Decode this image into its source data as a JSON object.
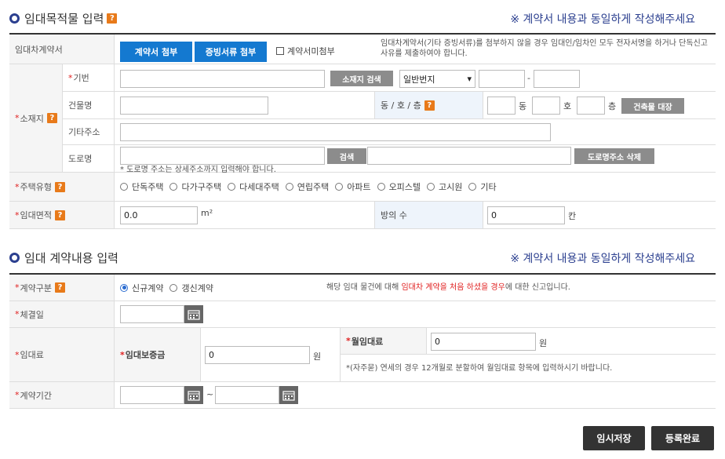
{
  "section1": {
    "title": "임대목적물 입력",
    "notice": "※ 계약서 내용과 동일하게 작성해주세요",
    "contract_row": {
      "label": "임대차계약서",
      "attach_contract": "계약서 첨부",
      "attach_proof": "증빙서류 첨부",
      "no_contract_label": "계약서미첨부",
      "note": "임대차계약서(기타 증빙서류)를 첨부하지 않을 경우 임대인/임차인 모두 전자서명을 하거나 단독신고 사유를 제출하여야 합니다."
    },
    "location": {
      "label": "소재지",
      "jibun_label": "기번",
      "search_location": "소재지 검색",
      "lot_type": "일반번지",
      "building_label": "건물명",
      "dong_ho_label": "동 / 호 / 층",
      "dong_unit": "동",
      "ho_unit": "호",
      "floor_unit": "층",
      "register_button": "건축물 대장",
      "other_addr_label": "기타주소",
      "road_label": "도로명",
      "search": "검색",
      "delete_road": "도로명주소 삭제",
      "road_note": "* 도로명 주소는 상세주소까지 입력해야 합니다."
    },
    "housing": {
      "label": "주택유형",
      "options": [
        "단독주택",
        "다가구주택",
        "다세대주택",
        "연립주택",
        "아파트",
        "오피스텔",
        "고시원",
        "기타"
      ]
    },
    "area": {
      "label": "임대면적",
      "value": "0.0",
      "unit": "m²",
      "rooms_label": "방의 수",
      "rooms_value": "0",
      "rooms_unit": "칸"
    }
  },
  "section2": {
    "title": "임대 계약내용 입력",
    "notice": "※ 계약서 내용과 동일하게 작성해주세요",
    "contract_type": {
      "label": "계약구분",
      "options": [
        "신규계약",
        "갱신계약"
      ],
      "note_pre": "해당 임대 물건에 대해 ",
      "note_red": "임대차 계약을 처음 하셨을 경우",
      "note_post": "에 대한 신고입니다."
    },
    "sign_date_label": "체결일",
    "rent": {
      "label": "임대료",
      "deposit_label": "임대보증금",
      "deposit_value": "0",
      "deposit_unit": "원",
      "monthly_label": "월임대료",
      "monthly_value": "0",
      "monthly_unit": "원",
      "monthly_note": "*(자주묻) 연세의 경우 12개월로 분할하여 월임대료 항목에 입력하시기 바랍니다."
    },
    "period": {
      "label": "계약기간",
      "separator": "~"
    }
  },
  "buttons": {
    "temp_save": "임시저장",
    "register_done": "등록완료"
  }
}
